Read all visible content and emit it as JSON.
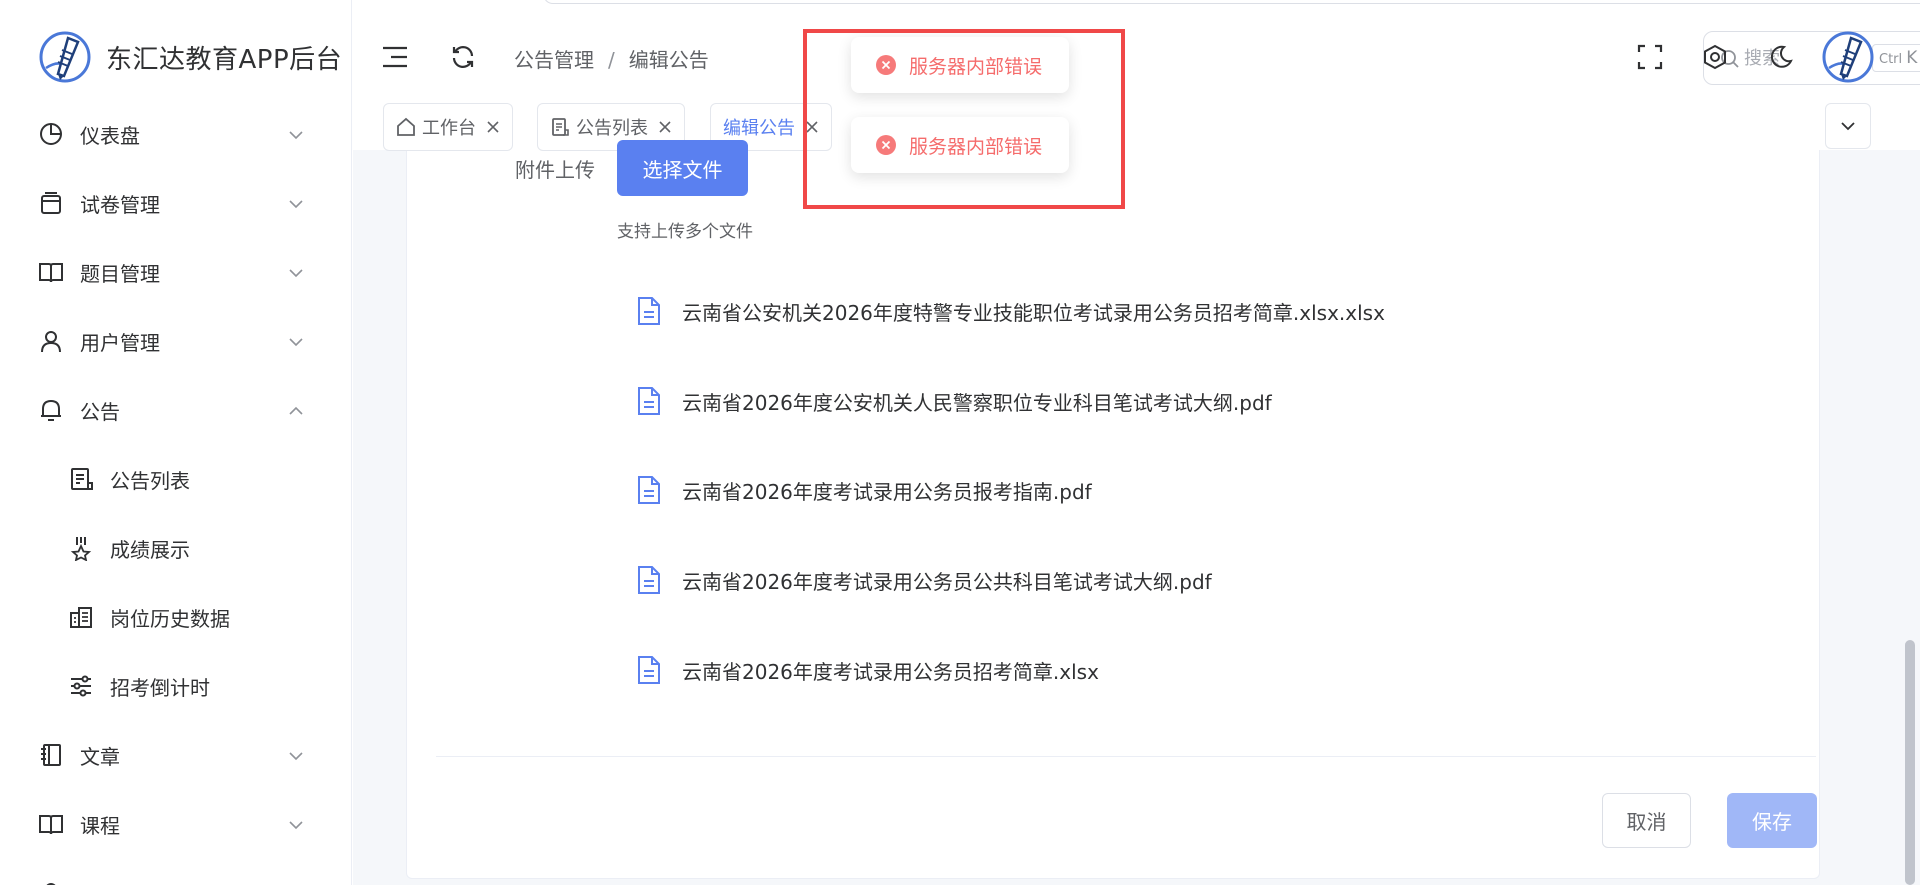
{
  "brand": {
    "title": "东汇达教育APP后台"
  },
  "colors": {
    "primary": "#5a80f0",
    "error": "#f56c6c",
    "highlight": "#f04848",
    "disabled_primary": "#a0b7f7"
  },
  "sidebar": {
    "items": [
      {
        "label": "仪表盘",
        "icon": "dashboard-icon",
        "expanded": false
      },
      {
        "label": "试卷管理",
        "icon": "document-icon",
        "expanded": false
      },
      {
        "label": "题目管理",
        "icon": "book-icon",
        "expanded": false
      },
      {
        "label": "用户管理",
        "icon": "user-icon",
        "expanded": false
      },
      {
        "label": "公告",
        "icon": "bell-icon",
        "expanded": true
      },
      {
        "label": "文章",
        "icon": "notebook-icon",
        "expanded": false
      },
      {
        "label": "课程",
        "icon": "book-open-icon",
        "expanded": false
      }
    ],
    "sub_items": [
      {
        "label": "公告列表",
        "icon": "list-doc-icon"
      },
      {
        "label": "成绩展示",
        "icon": "medal-icon"
      },
      {
        "label": "岗位历史数据",
        "icon": "office-building-icon"
      },
      {
        "label": "招考倒计时",
        "icon": "sliders-icon"
      }
    ]
  },
  "header": {
    "breadcrumb": [
      "公告管理",
      "编辑公告"
    ],
    "search": {
      "placeholder": "搜索",
      "shortcut_ctrl": "Ctrl",
      "shortcut_key": "K"
    }
  },
  "tabs": [
    {
      "label": "工作台",
      "icon": "home-icon"
    },
    {
      "label": "公告列表",
      "icon": "list-doc-icon"
    },
    {
      "label": "编辑公告",
      "active": true
    }
  ],
  "form": {
    "attachment_label": "附件上传",
    "upload_button": "选择文件",
    "upload_tip": "支持上传多个文件",
    "files": [
      "云南省公安机关2026年度特警专业技能职位考试录用公务员招考简章.xlsx.xlsx",
      "云南省2026年度公安机关人民警察职位专业科目笔试考试大纲.pdf",
      "云南省2026年度考试录用公务员报考指南.pdf",
      "云南省2026年度考试录用公务员公共科目笔试考试大纲.pdf",
      "云南省2026年度考试录用公务员招考简章.xlsx"
    ],
    "cancel_button": "取消",
    "save_button": "保存"
  },
  "toasts": [
    {
      "type": "error",
      "message": "服务器内部错误"
    },
    {
      "type": "error",
      "message": "服务器内部错误"
    }
  ]
}
